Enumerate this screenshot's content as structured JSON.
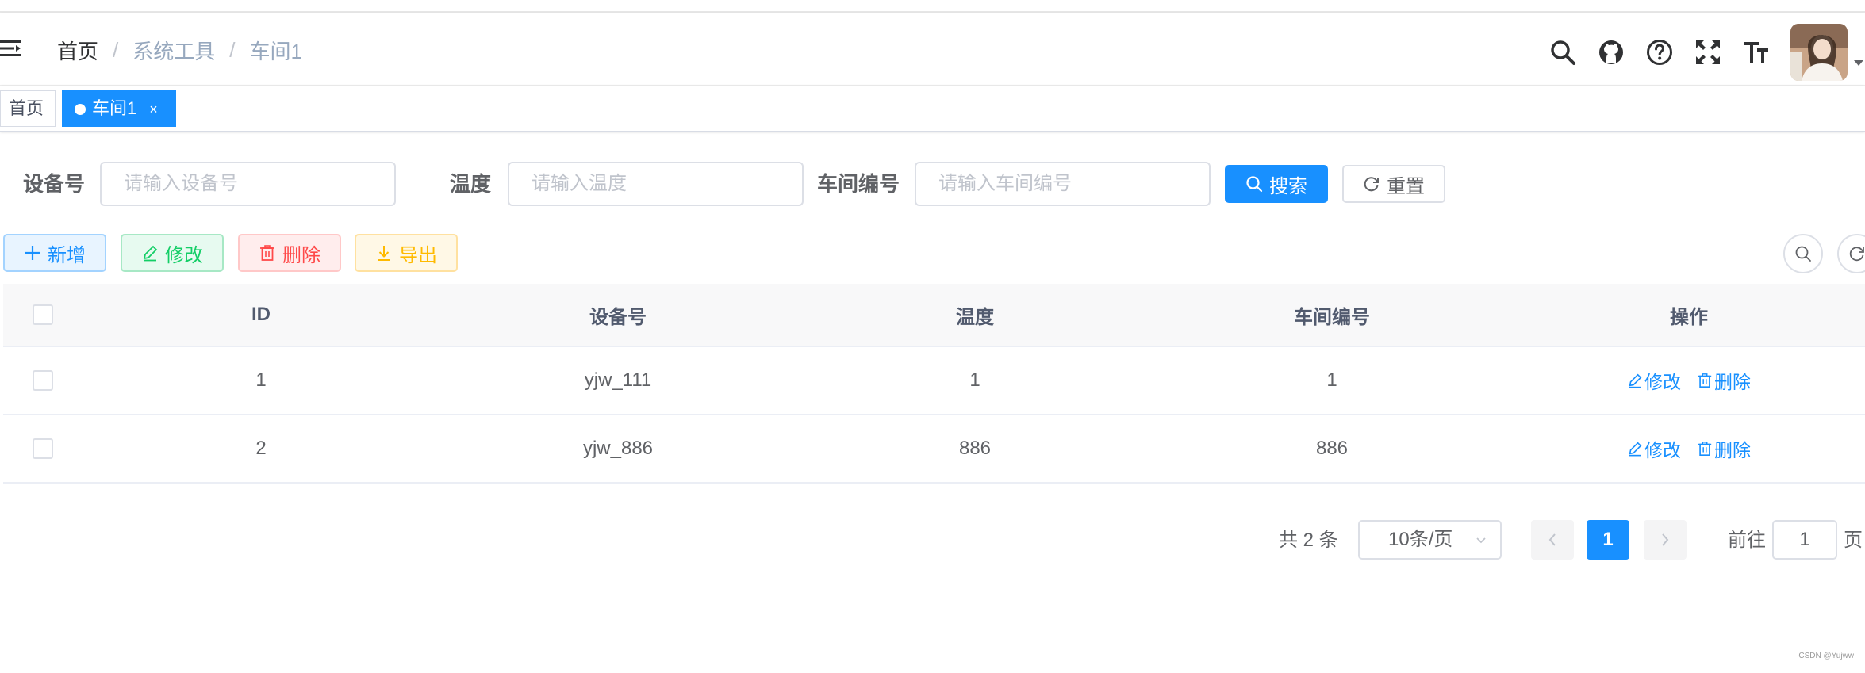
{
  "breadcrumb": {
    "home": "首页",
    "separator": "/",
    "level1": "系统工具",
    "level2": "车间1"
  },
  "header_icons": [
    "search-icon",
    "github-icon",
    "question-icon",
    "fullscreen-icon",
    "font-size-icon"
  ],
  "tags": {
    "home": "首页",
    "active": "车间1",
    "close": "×"
  },
  "search_form": {
    "device_label": "设备号",
    "device_placeholder": "请输入设备号",
    "temp_label": "温度",
    "temp_placeholder": "请输入温度",
    "workshop_label": "车间编号",
    "workshop_placeholder": "请输入车间编号",
    "search_btn": "搜索",
    "reset_btn": "重置"
  },
  "toolbar": {
    "add": "新增",
    "edit": "修改",
    "delete": "删除",
    "export": "导出"
  },
  "table": {
    "headers": [
      "ID",
      "设备号",
      "温度",
      "车间编号",
      "操作"
    ],
    "rows": [
      {
        "id": "1",
        "device": "yjw_111",
        "temp": "1",
        "workshop": "1",
        "edit": "修改",
        "delete": "删除"
      },
      {
        "id": "2",
        "device": "yjw_886",
        "temp": "886",
        "workshop": "886",
        "edit": "修改",
        "delete": "删除"
      }
    ]
  },
  "pagination": {
    "total": "共 2 条",
    "page_size": "10条/页",
    "current": "1",
    "goto_label": "前往",
    "goto_value": "1",
    "goto_suffix": "页"
  },
  "watermark": "CSDN @Yujww",
  "colors": {
    "primary": "#1890ff",
    "success": "#13ce66",
    "danger": "#ff4949",
    "warning": "#ffba00"
  }
}
